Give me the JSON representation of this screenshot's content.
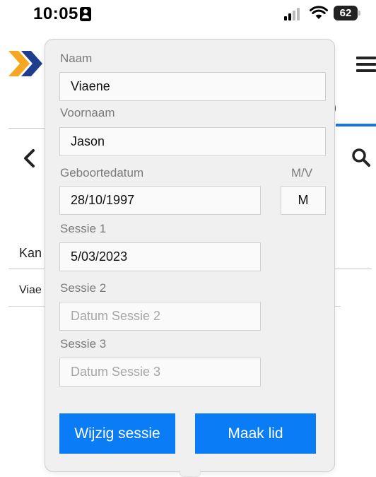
{
  "status_bar": {
    "time": "10:05",
    "battery": "62"
  },
  "background": {
    "table_header_partial": "Kan",
    "row_partial": "Viae"
  },
  "form": {
    "naam": {
      "label": "Naam",
      "value": "Viaene"
    },
    "voornaam": {
      "label": "Voornaam",
      "value": "Jason"
    },
    "geboortedatum": {
      "label": "Geboortedatum",
      "value": "28/10/1997"
    },
    "geslacht": {
      "label": "M/V",
      "value": "M"
    },
    "sessie1": {
      "label": "Sessie 1",
      "value": "5/03/2023"
    },
    "sessie2": {
      "label": "Sessie 2",
      "placeholder": "Datum Sessie 2"
    },
    "sessie3": {
      "label": "Sessie 3",
      "placeholder": "Datum Sessie 3"
    }
  },
  "buttons": {
    "wijzig_sessie": "Wijzig sessie",
    "maak_lid": "Maak lid"
  },
  "colors": {
    "accent_blue": "#0a7cf5",
    "logo_orange": "#f5a623",
    "logo_blue": "#1f3d8f"
  }
}
